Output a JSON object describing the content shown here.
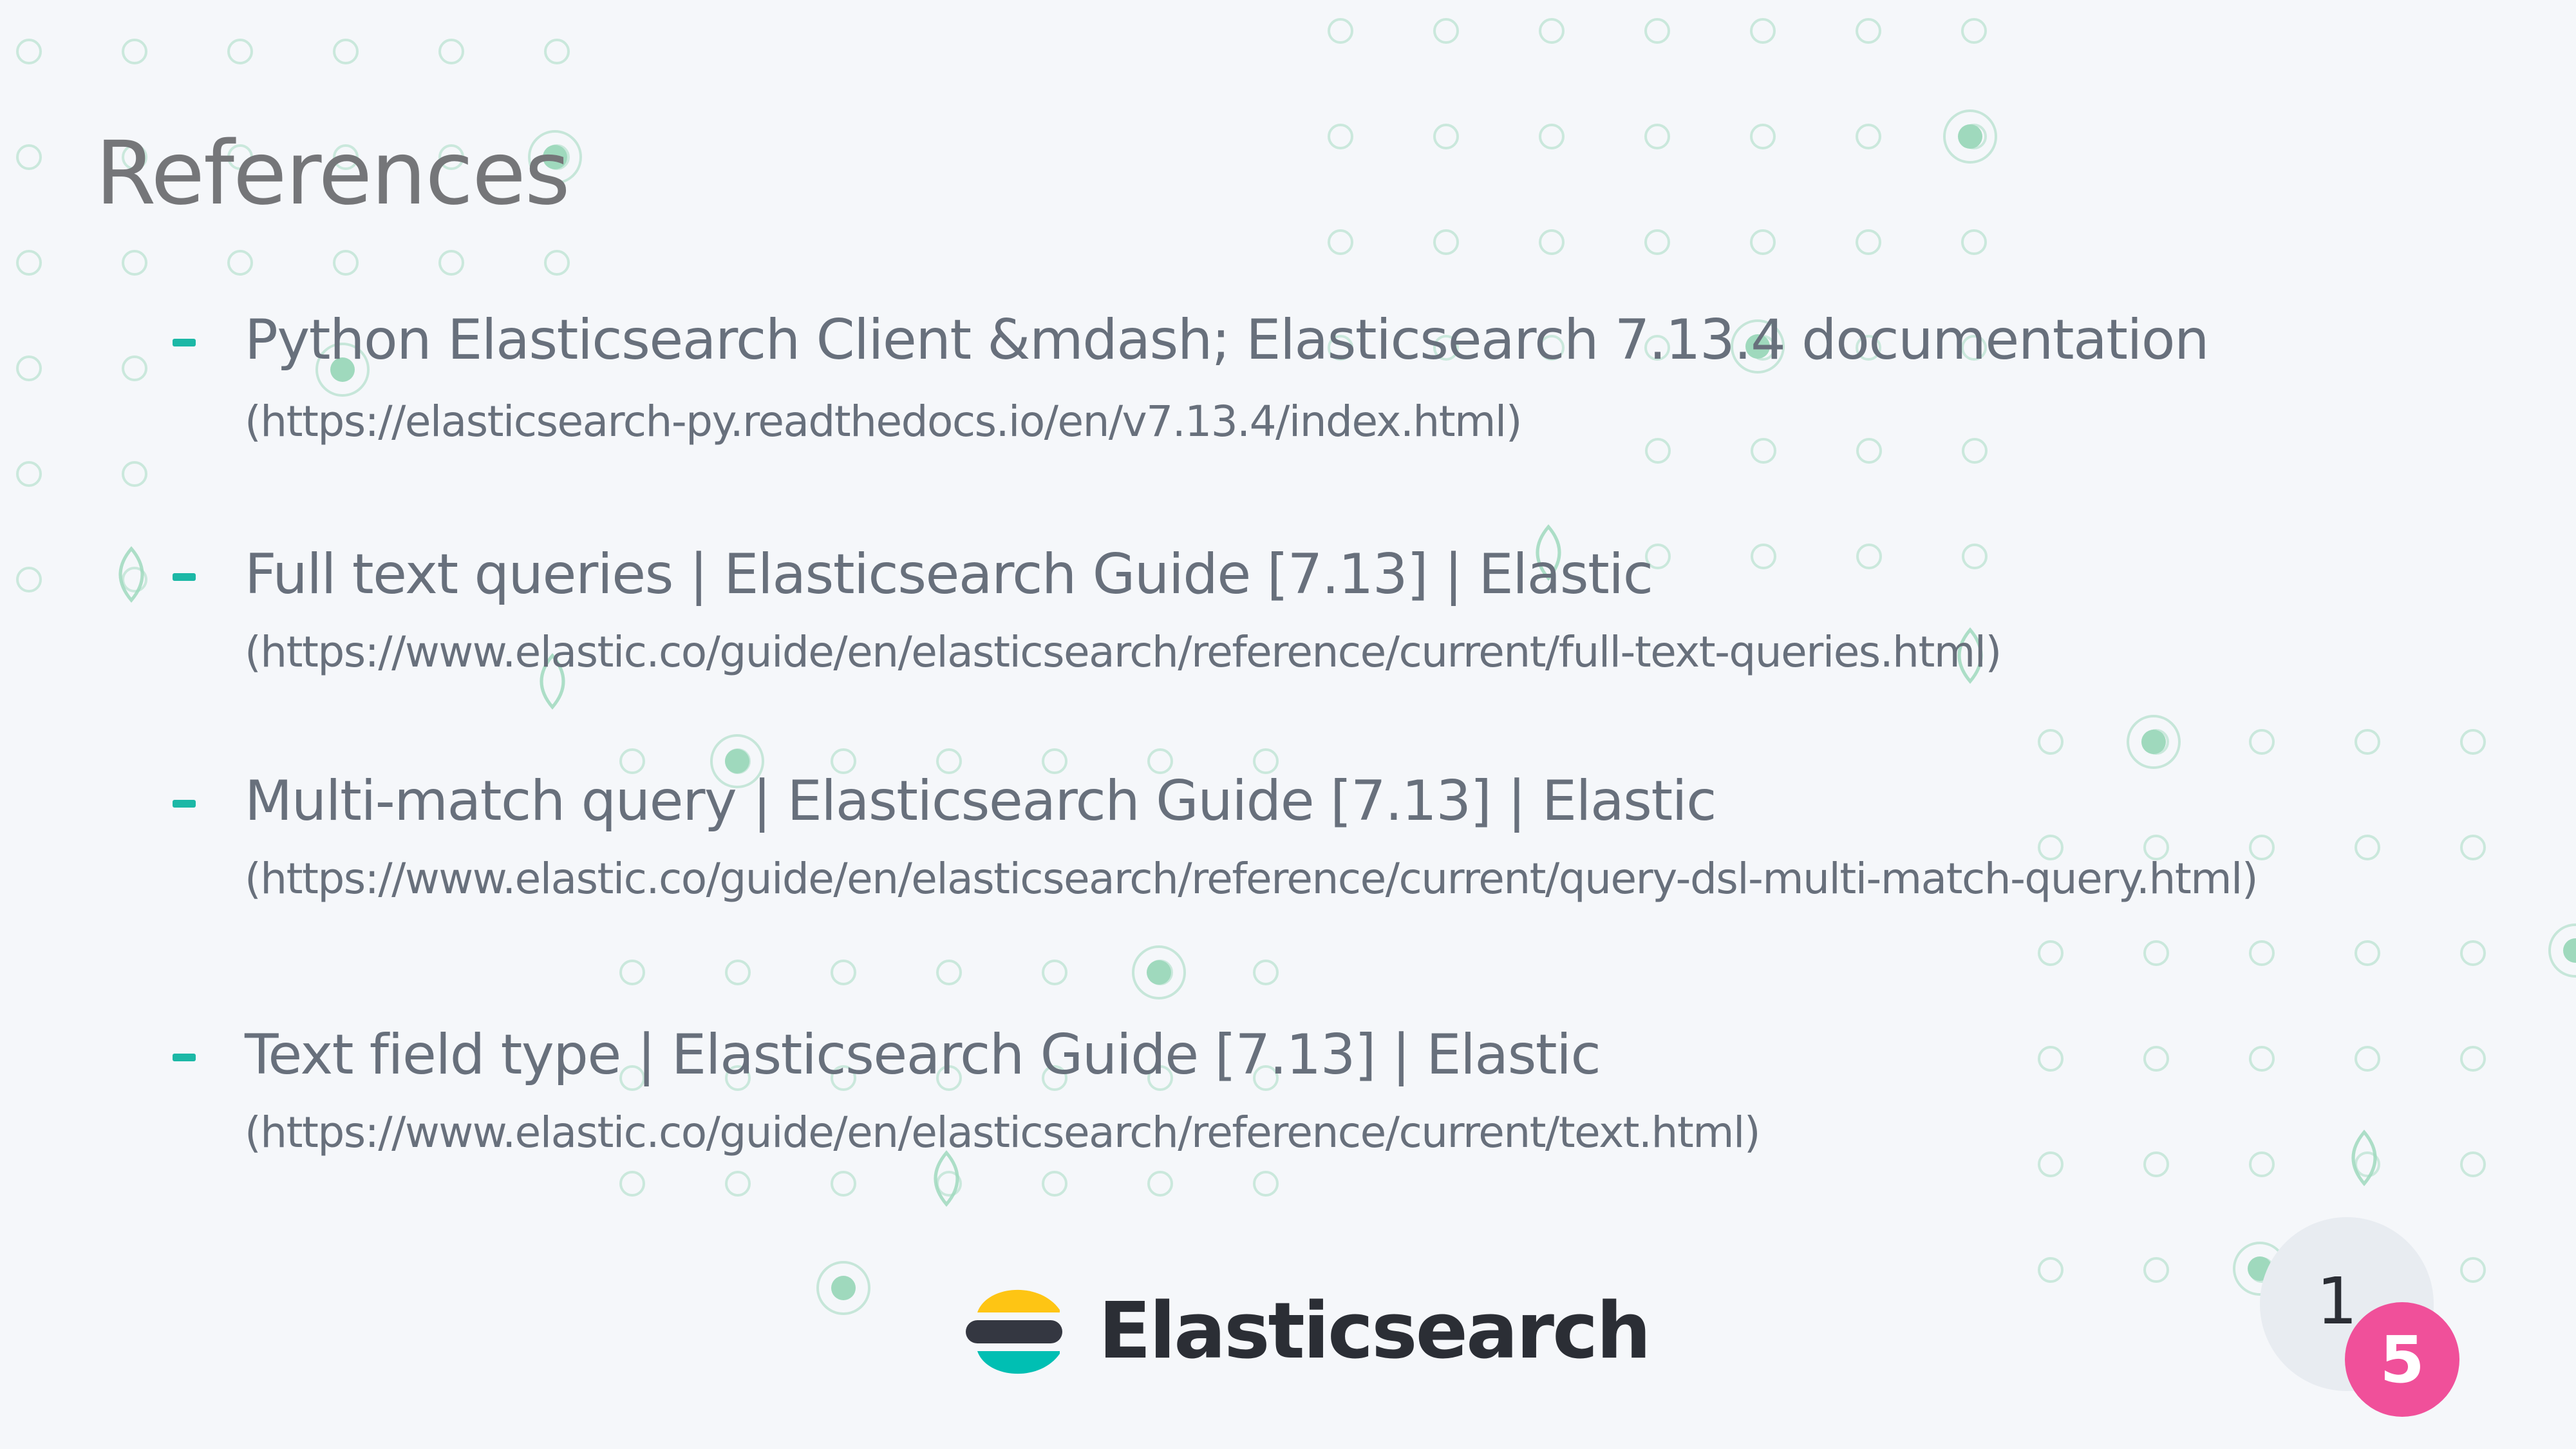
{
  "slide": {
    "title": "References"
  },
  "references": [
    {
      "title": "Python Elasticsearch Client &mdash; Elasticsearch 7.13.4 documentation",
      "url": "(https://elasticsearch-py.readthedocs.io/en/v7.13.4/index.html)"
    },
    {
      "title": "Full text queries | Elasticsearch Guide [7.13] | Elastic",
      "url": "(https://www.elastic.co/guide/en/elasticsearch/reference/current/full-text-queries.html)"
    },
    {
      "title": "Multi-match query | Elasticsearch Guide [7.13] | Elastic",
      "url": "(https://www.elastic.co/guide/en/elasticsearch/reference/current/query-dsl-multi-match-query.html)"
    },
    {
      "title": "Text field type | Elasticsearch Guide [7.13] | Elastic",
      "url": "(https://www.elastic.co/guide/en/elasticsearch/reference/current/text.html)"
    }
  ],
  "footer": {
    "brand_name": "Elasticsearch",
    "page_number_first": "1",
    "page_number_second": "5"
  },
  "colors": {
    "background": "#f5f7fa",
    "title": "#757679",
    "body_text": "#68707c",
    "accent_teal": "#1cb8a6",
    "pattern_green": "#9fd9bd",
    "logo_yellow": "#fec514",
    "logo_dark": "#343741",
    "logo_teal": "#00bfb3",
    "badge_pink": "#f0509a"
  }
}
